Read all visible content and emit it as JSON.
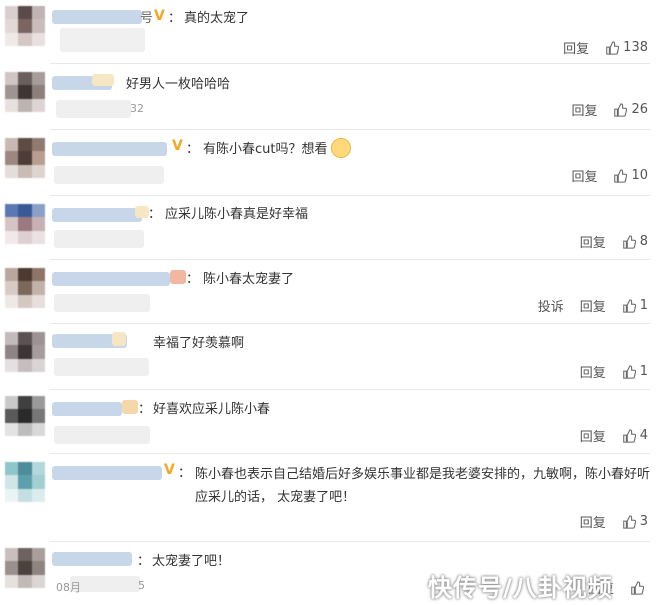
{
  "actions": {
    "reply": "回复",
    "report": "投诉"
  },
  "comments": [
    {
      "text": "真的太宠了",
      "likes": "138",
      "badge": "V",
      "name_tail": "号"
    },
    {
      "text": "好男人一枚哈哈哈",
      "likes": "26",
      "meta_tail": "32"
    },
    {
      "text": "有陈小春cut吗？想看",
      "likes": "10",
      "badge": "V",
      "emoji": "smile-emoji"
    },
    {
      "text": "应采儿陈小春真是好幸福",
      "likes": "8"
    },
    {
      "text": "陈小春太宠妻了",
      "likes": "1",
      "has_report": true
    },
    {
      "text": "幸福了好羡慕啊",
      "likes": "1"
    },
    {
      "text": "好喜欢应采儿陈小春",
      "likes": "4"
    },
    {
      "text": "陈小春也表示自己结婚后好多娱乐事业都是我老婆安排的，九敏啊，陈小春好听应采儿的话， 太宠妻了吧！",
      "likes": "3",
      "badge": "V"
    },
    {
      "text": "太宠妻了吧！",
      "likes": "",
      "meta_tail": "08月",
      "meta_tail2": "5"
    }
  ],
  "watermark": "快传号/八卦视频",
  "colors": {
    "accent": "#f5a623",
    "divider": "#e8e8e8",
    "text": "#333333",
    "muted": "#999999"
  },
  "icons": {
    "like": "thumbs-up-icon"
  }
}
